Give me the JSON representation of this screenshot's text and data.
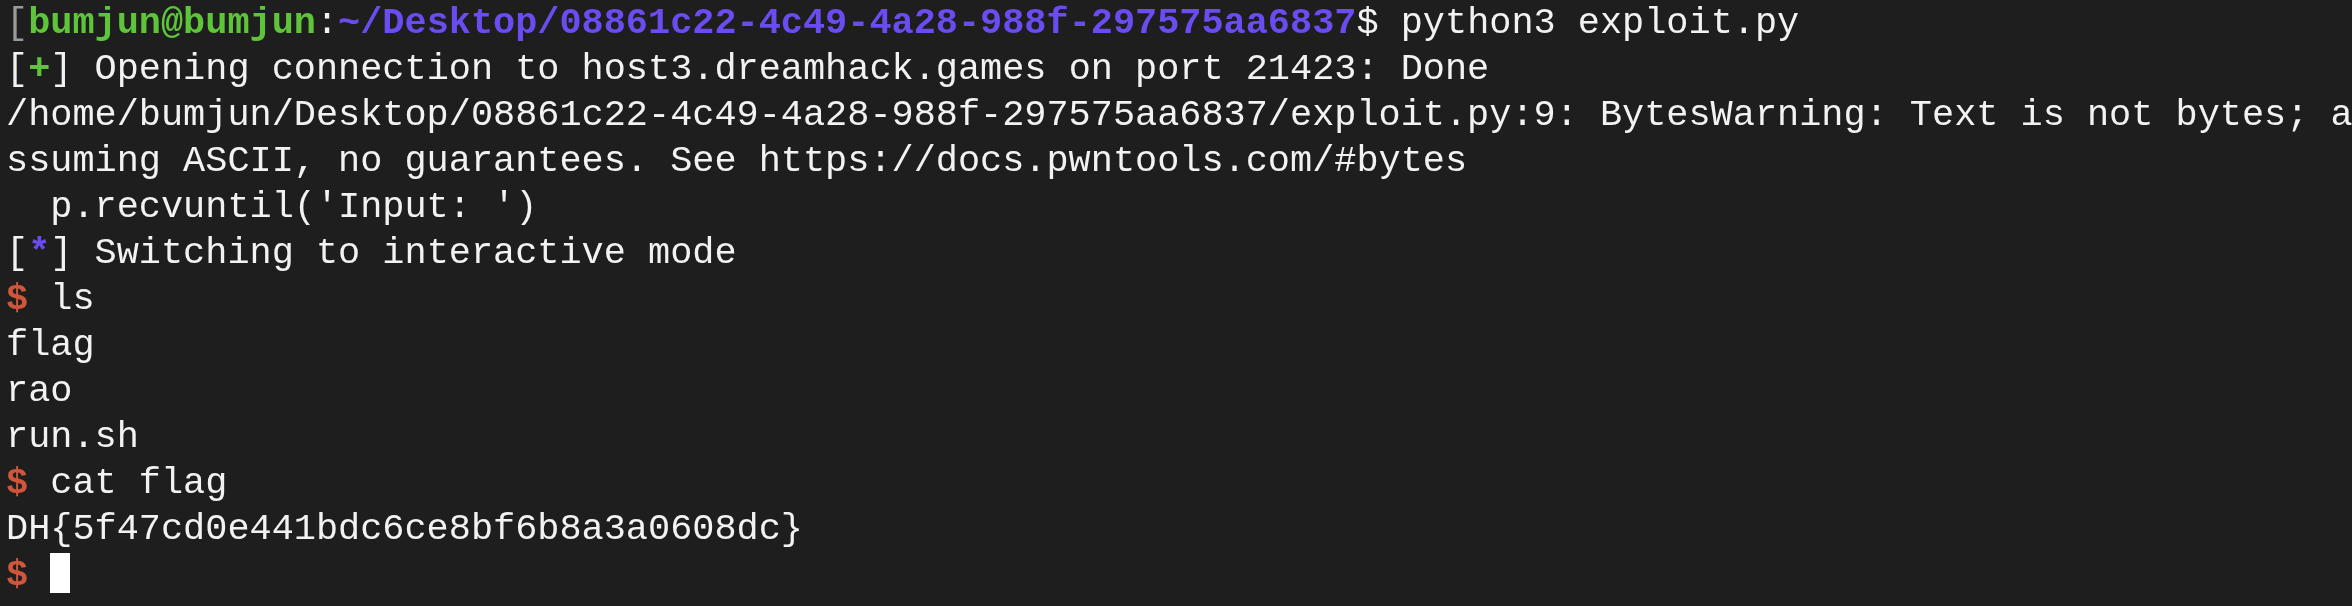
{
  "terminal": {
    "lines": [
      {
        "kind": "shell_prompt",
        "bracket": "[",
        "user": "bumjun@bumjun",
        "separator": ":",
        "path": "~/Desktop/08861c22-4c49-4a28-988f-297575aa6837",
        "symbol": "$",
        "command": "python3 exploit.py"
      },
      {
        "kind": "status",
        "open": "[",
        "close": "]",
        "marker": "+",
        "color": "#5ec43a",
        "text": "Opening connection to host3.dreamhack.games on port 21423: Done"
      },
      {
        "kind": "output",
        "text": "/home/bumjun/Desktop/08861c22-4c49-4a28-988f-297575aa6837/exploit.py:9: BytesWarning: Text is not bytes; a"
      },
      {
        "kind": "output",
        "text": "ssuming ASCII, no guarantees. See https://docs.pwntools.com/#bytes"
      },
      {
        "kind": "output",
        "text": "  p.recvuntil('Input: ')"
      },
      {
        "kind": "status",
        "open": "[",
        "close": "]",
        "marker": "*",
        "color": "#6a4cf0",
        "text": "Switching to interactive mode"
      },
      {
        "kind": "remote_prompt",
        "symbol": "$",
        "command": "ls"
      },
      {
        "kind": "output",
        "text": "flag"
      },
      {
        "kind": "output",
        "text": "rao"
      },
      {
        "kind": "output",
        "text": "run.sh"
      },
      {
        "kind": "remote_prompt",
        "symbol": "$",
        "command": "cat flag"
      },
      {
        "kind": "output",
        "text": "DH{5f47cd0e441bdc6ce8bf6b8a3a0608dc}"
      },
      {
        "kind": "cursor_prompt",
        "symbol": "$"
      }
    ]
  }
}
